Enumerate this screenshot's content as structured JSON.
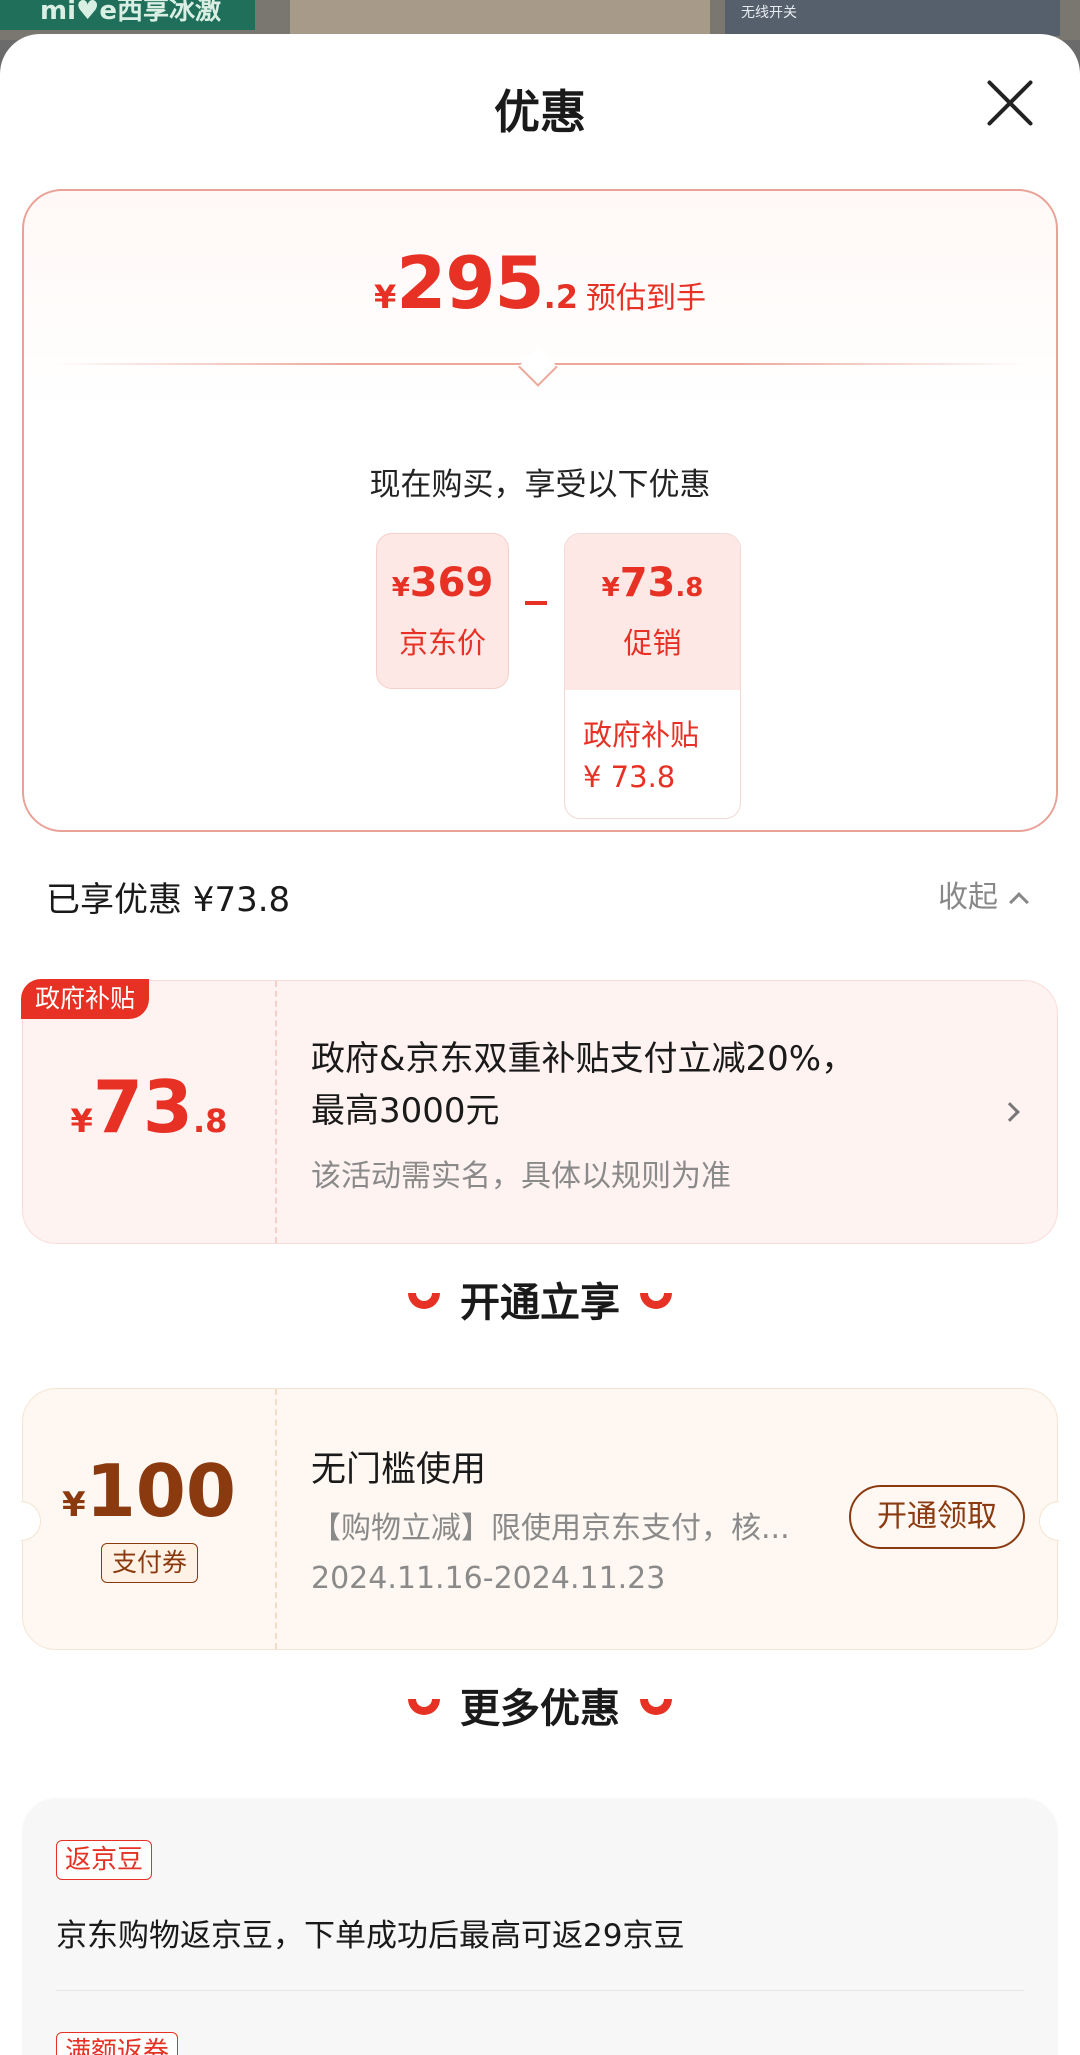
{
  "background": {
    "left_banner": "mi♥e西享冰激",
    "right_tile": "无线开关"
  },
  "sheet": {
    "title": "优惠"
  },
  "summary": {
    "estimate_yen": "¥",
    "estimate_int": "295",
    "estimate_dec": ".2",
    "estimate_label": "预估到手",
    "buy_text": "现在购买，享受以下优惠",
    "jd_price": {
      "yen": "¥",
      "amount": "369",
      "label": "京东价"
    },
    "promo": {
      "yen": "¥",
      "amount": "73",
      "dec": ".8",
      "label": "促销",
      "sub_label": "政府补贴",
      "sub_value": "¥ 73.8"
    }
  },
  "enjoyed": {
    "label": "已享优惠 ¥73.8",
    "collapse_label": "收起"
  },
  "gov_card": {
    "tag": "政府补贴",
    "yen": "¥",
    "amount": "73",
    "dec": ".8",
    "title": "政府&京东双重补贴支付立减20%，最高3000元",
    "note": "该活动需实名，具体以规则为准"
  },
  "section_open": {
    "title": "开通立享"
  },
  "coupon": {
    "yen": "¥",
    "amount": "100",
    "type": "支付券",
    "title": "无门槛使用",
    "desc": "【购物立减】限使用京东支付，核...",
    "date": "2024.11.16-2024.11.23",
    "button": "开通领取"
  },
  "section_more": {
    "title": "更多优惠"
  },
  "more": {
    "items": [
      {
        "tag": "返京豆",
        "text": "京东购物返京豆，下单成功后最高可返29京豆"
      },
      {
        "tag": "满额返券",
        "text": ""
      }
    ]
  },
  "colors": {
    "accent_red": "#e63124",
    "coupon_brown": "#8b3a10"
  }
}
